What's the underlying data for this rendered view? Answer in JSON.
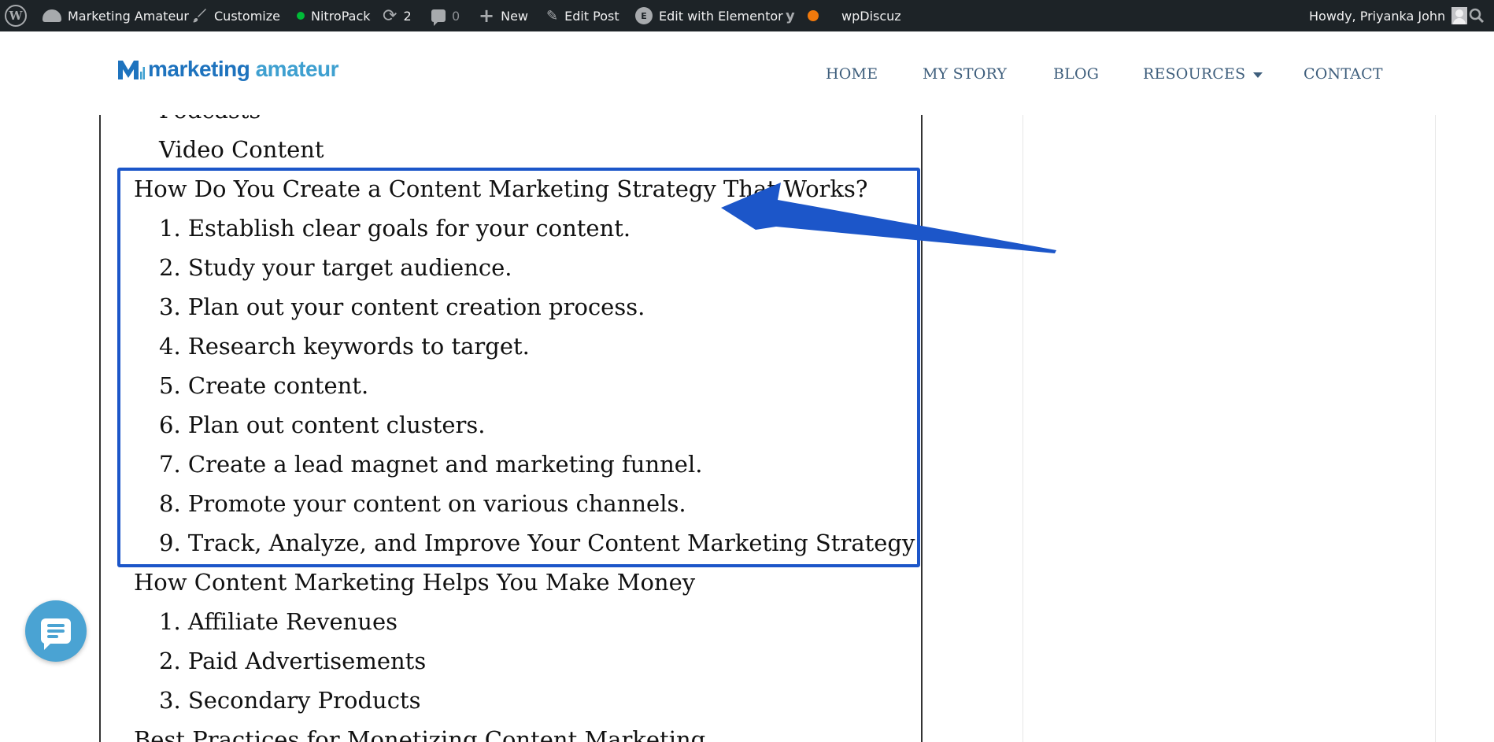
{
  "adminbar": {
    "site_name": "Marketing Amateur",
    "customize": "Customize",
    "nitropack": "NitroPack",
    "updates_count": "2",
    "comments_count": "0",
    "new": "New",
    "edit_post": "Edit Post",
    "edit_elementor": "Edit with Elementor",
    "wpdiscuz": "wpDiscuz",
    "howdy": "Howdy, Priyanka John",
    "colors": {
      "status_green": "#00ba37",
      "status_orange": "#f0790c"
    }
  },
  "header": {
    "logo_text_dark": "marketing",
    "logo_text_light": " amateur",
    "nav": [
      "HOME",
      "MY STORY",
      "BLOG",
      "RESOURCES",
      "CONTACT"
    ]
  },
  "toc": {
    "partial_top": "Podcasts",
    "video_content": "Video Content",
    "section1_title": "How Do You Create a Content Marketing Strategy That Works?",
    "section1_items": [
      "1. Establish clear goals for your content.",
      "2. Study your target audience.",
      "3. Plan out your content creation process.",
      "4. Research keywords to target.",
      "5. Create content.",
      "6. Plan out content clusters.",
      "7. Create a lead magnet and marketing funnel.",
      "8. Promote your content on various channels.",
      "9. Track, Analyze, and Improve Your Content Marketing Strategy"
    ],
    "section2_title": "How Content Marketing Helps You Make Money",
    "section2_items": [
      "1. Affiliate Revenues",
      "2. Paid Advertisements",
      "3. Secondary Products"
    ],
    "section3_title": "Best Practices for Monetizing Content Marketing"
  },
  "annotation": {
    "color": "#1c56c9"
  },
  "icons": [
    "wordpress-icon",
    "dashboard-icon",
    "brush-icon",
    "refresh-icon",
    "comment-icon",
    "plus-icon",
    "pencil-icon",
    "elementor-icon",
    "yoast-icon",
    "search-icon",
    "chat-icon"
  ]
}
